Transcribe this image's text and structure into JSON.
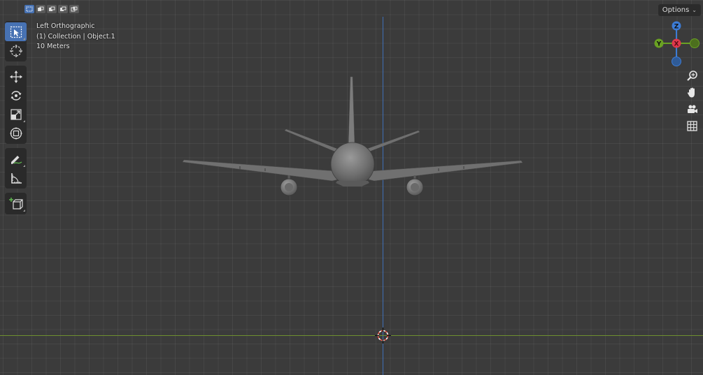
{
  "viewport": {
    "view_name": "Left Orthographic",
    "collection_info": "(1) Collection | Object.1",
    "scale_info": "10 Meters"
  },
  "header": {
    "options_label": "Options",
    "selection_modes": [
      "select-new",
      "select-extend",
      "select-subtract",
      "select-difference",
      "select-intersect"
    ]
  },
  "toolbar": {
    "tools": [
      "select-box",
      "cursor",
      "move",
      "rotate",
      "scale",
      "transform",
      "annotate",
      "measure",
      "add-cube"
    ]
  },
  "gizmo": {
    "z_label": "Z",
    "y_label": "Y",
    "x_label": "X",
    "colors": {
      "x": "#e0384c",
      "y": "#6aa123",
      "z": "#3c7cd6"
    }
  },
  "nav_buttons": [
    "zoom",
    "pan",
    "camera",
    "ortho-grid"
  ],
  "colors": {
    "active_tool": "#4772b3",
    "grid_bg": "#3b3b3b",
    "axis_vertical": "#3f6fb6",
    "axis_horizontal": "#6d8f2f"
  }
}
